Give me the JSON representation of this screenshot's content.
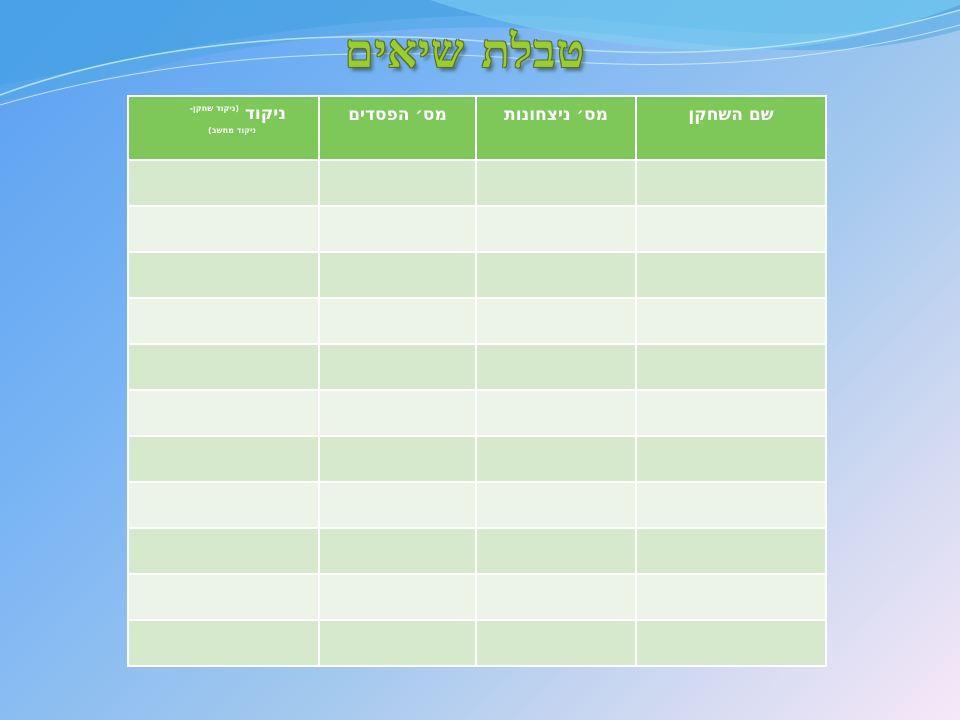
{
  "slide": {
    "title": "טבלת שיאים"
  },
  "table": {
    "headers": {
      "player_name": "שם השחקן",
      "wins": "מס׳ ניצחונות",
      "losses": "מס׳ הפסדים",
      "score": "ניקוד",
      "score_note_line1": "(ניקוד שחקן-",
      "score_note_line2": "ניקוד מחשב)"
    },
    "rows": [
      [
        "",
        "",
        "",
        ""
      ],
      [
        "",
        "",
        "",
        ""
      ],
      [
        "",
        "",
        "",
        ""
      ],
      [
        "",
        "",
        "",
        ""
      ],
      [
        "",
        "",
        "",
        ""
      ],
      [
        "",
        "",
        "",
        ""
      ],
      [
        "",
        "",
        "",
        ""
      ],
      [
        "",
        "",
        "",
        ""
      ],
      [
        "",
        "",
        "",
        ""
      ],
      [
        "",
        "",
        "",
        ""
      ],
      [
        "",
        "",
        "",
        ""
      ]
    ]
  },
  "colors": {
    "header_green": "#7ec85a",
    "row_dark": "#d6e9cd",
    "row_light": "#ebf4e7",
    "title_green": "#9acd32"
  }
}
